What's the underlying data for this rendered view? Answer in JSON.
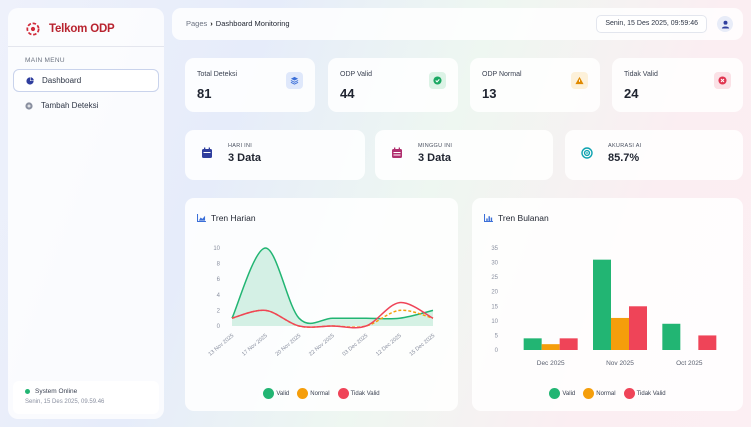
{
  "sidebar": {
    "brand": "Telkom ODP",
    "menu_title": "MAIN MENU",
    "items": [
      {
        "label": "Dashboard",
        "icon": "pie-chart-icon"
      },
      {
        "label": "Tambah Deteksi",
        "icon": "plus-circle-icon"
      }
    ],
    "status": "System Online",
    "status_time": "Senin, 15 Des 2025, 09.59.46"
  },
  "header": {
    "breadcrumb_root": "Pages",
    "breadcrumb_current": "Dashboard Monitoring",
    "datetime": "Senin, 15 Des 2025, 09:59:46",
    "user_icon": "user-icon"
  },
  "stats": [
    {
      "label": "Total Deteksi",
      "value": "81",
      "icon": "layers-icon",
      "color": "#3b6fd8",
      "bg": "#dfe8fb"
    },
    {
      "label": "ODP Valid",
      "value": "44",
      "icon": "check-circle-icon",
      "color": "#1aa862",
      "bg": "#dcf3e6"
    },
    {
      "label": "ODP Normal",
      "value": "13",
      "icon": "warning-icon",
      "color": "#e08a00",
      "bg": "#fdf1d9"
    },
    {
      "label": "Tidak Valid",
      "value": "24",
      "icon": "x-circle-icon",
      "color": "#e0344f",
      "bg": "#fbe1e6"
    }
  ],
  "wide_stats": [
    {
      "label": "HARI INI",
      "value": "3 Data",
      "icon": "calendar-icon",
      "color": "#2f3e9e"
    },
    {
      "label": "MINGGU INI",
      "value": "3 Data",
      "icon": "calendar-week-icon",
      "color": "#b0306f"
    },
    {
      "label": "AKURASI AI",
      "value": "85.7%",
      "icon": "target-icon",
      "color": "#0fa3b1"
    }
  ],
  "colors": {
    "valid": "#22b573",
    "normal": "#f59e0b",
    "tidak_valid": "#ef4458"
  },
  "legend": [
    "Valid",
    "Normal",
    "Tidak Valid"
  ],
  "chart_data": [
    {
      "type": "area",
      "title": "Tren Harian",
      "x": [
        "13 Nov 2025",
        "17 Nov 2025",
        "20 Nov 2025",
        "22 Nov 2025",
        "03 Dec 2025",
        "12 Dec 2025",
        "15 Dec 2025"
      ],
      "y_ticks": [
        0,
        2,
        4,
        6,
        8,
        10
      ],
      "ylim": [
        0,
        10
      ],
      "series": [
        {
          "name": "Valid",
          "values": [
            1,
            10,
            1,
            1,
            1,
            1,
            2
          ]
        },
        {
          "name": "Normal",
          "values": [
            1,
            2,
            0,
            0,
            0,
            2,
            1
          ]
        },
        {
          "name": "Tidak Valid",
          "values": [
            1,
            2,
            0,
            0,
            0,
            3,
            1
          ]
        }
      ],
      "legend": "bottom"
    },
    {
      "type": "bar",
      "title": "Tren Bulanan",
      "categories": [
        "Dec 2025",
        "Nov 2025",
        "Oct 2025"
      ],
      "y_ticks": [
        0,
        5,
        10,
        15,
        20,
        25,
        30,
        35
      ],
      "ylim": [
        0,
        35
      ],
      "series": [
        {
          "name": "Valid",
          "values": [
            4,
            31,
            9
          ]
        },
        {
          "name": "Normal",
          "values": [
            2,
            11,
            0
          ]
        },
        {
          "name": "Tidak Valid",
          "values": [
            4,
            15,
            5
          ]
        }
      ],
      "legend": "bottom"
    }
  ]
}
